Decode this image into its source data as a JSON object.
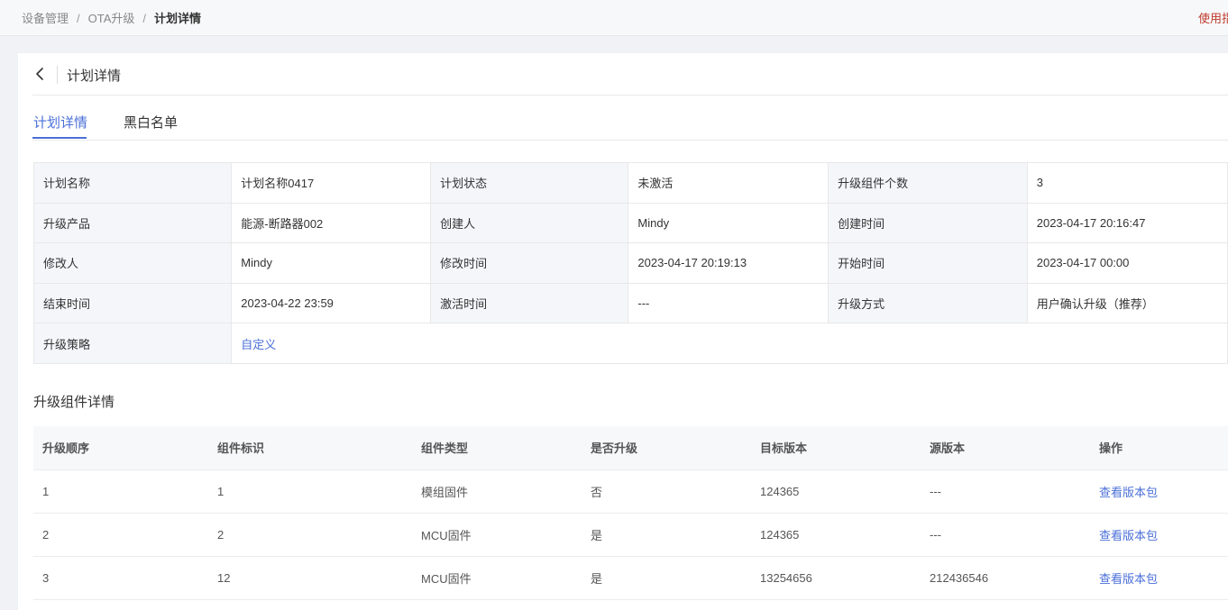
{
  "breadcrumb": {
    "items": [
      "设备管理",
      "OTA升级",
      "计划详情"
    ],
    "separator": "/"
  },
  "help_link": "使用指",
  "header": {
    "back_icon": "chevron-left-icon",
    "title": "计划详情"
  },
  "tabs": [
    {
      "label": "计划详情",
      "active": true
    },
    {
      "label": "黑白名单",
      "active": false
    }
  ],
  "details": {
    "rows": [
      [
        {
          "label": "计划名称",
          "value": "计划名称0417"
        },
        {
          "label": "计划状态",
          "value": "未激活"
        },
        {
          "label": "升级组件个数",
          "value": "3"
        }
      ],
      [
        {
          "label": "升级产品",
          "value": "能源-断路器002"
        },
        {
          "label": "创建人",
          "value": "Mindy"
        },
        {
          "label": "创建时间",
          "value": "2023-04-17 20:16:47"
        }
      ],
      [
        {
          "label": "修改人",
          "value": "Mindy"
        },
        {
          "label": "修改时间",
          "value": "2023-04-17 20:19:13"
        },
        {
          "label": "开始时间",
          "value": "2023-04-17 00:00"
        }
      ],
      [
        {
          "label": "结束时间",
          "value": "2023-04-22 23:59"
        },
        {
          "label": "激活时间",
          "value": "---"
        },
        {
          "label": "升级方式",
          "value": "用户确认升级（推荐）"
        }
      ]
    ],
    "strategy": {
      "label": "升级策略",
      "value": "自定义"
    }
  },
  "components": {
    "title": "升级组件详情",
    "columns": [
      "升级顺序",
      "组件标识",
      "组件类型",
      "是否升级",
      "目标版本",
      "源版本",
      "操作"
    ],
    "rows": [
      {
        "order": "1",
        "id": "1",
        "type": "模组固件",
        "upgrade": "否",
        "target": "124365",
        "source": "---",
        "action": "查看版本包"
      },
      {
        "order": "2",
        "id": "2",
        "type": "MCU固件",
        "upgrade": "是",
        "target": "124365",
        "source": "---",
        "action": "查看版本包"
      },
      {
        "order": "3",
        "id": "12",
        "type": "MCU固件",
        "upgrade": "是",
        "target": "13254656",
        "source": "212436546",
        "action": "查看版本包"
      }
    ]
  },
  "colors": {
    "accent": "#4a6fd8",
    "label_bg": "#f5f6fa",
    "help_link": "#c0392b"
  }
}
